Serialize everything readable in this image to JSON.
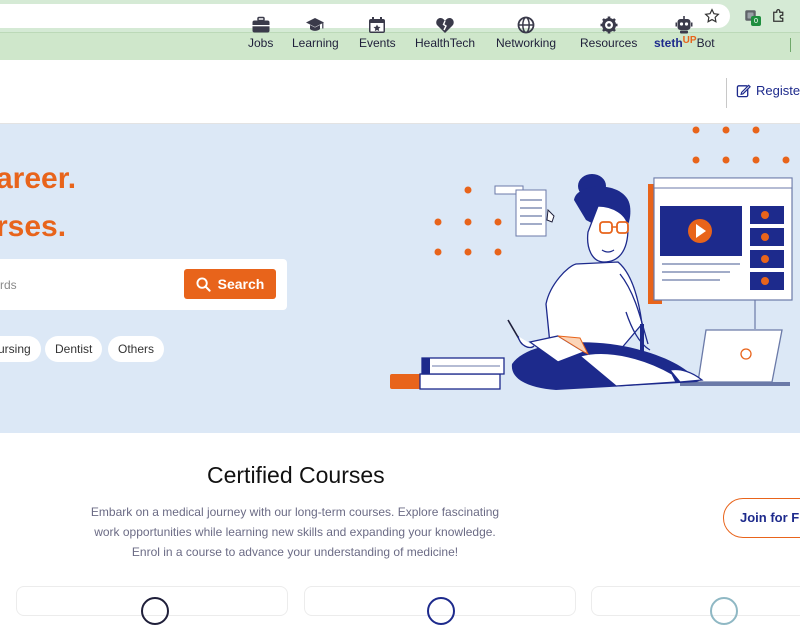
{
  "colors": {
    "accent": "#e8641b",
    "brand": "#1d2a8c",
    "hero_bg": "#dce8f6",
    "chrome_green": "#cfe7cb"
  },
  "browser": {
    "extension_badge": "0"
  },
  "nav": {
    "items": [
      {
        "label": "Jobs",
        "icon": "briefcase-icon"
      },
      {
        "label": "Learning",
        "icon": "graduation-cap-icon"
      },
      {
        "label": "Events",
        "icon": "calendar-icon"
      },
      {
        "label": "HealthTech",
        "icon": "broken-heart-icon"
      },
      {
        "label": "Networking",
        "icon": "globe-icon"
      },
      {
        "label": "Resources",
        "icon": "gear-icon"
      }
    ],
    "bot": {
      "prefix": "steth",
      "mid": "UP",
      "suffix": "Bot",
      "icon": "robot-icon"
    },
    "register_label": "Register"
  },
  "hero": {
    "line1": "areer.",
    "line2": "rses.",
    "search_placeholder": "rds",
    "search_button": "Search",
    "chips": [
      "ursing",
      "Dentist",
      "Others"
    ]
  },
  "courses": {
    "title": "Certified Courses",
    "description": "Embark on a medical journey with our long-term courses. Explore fascinating work opportunities while learning new skills and expanding your knowledge. Enrol in a course to advance your understanding of medicine!",
    "join_button": "Join for Fr"
  }
}
